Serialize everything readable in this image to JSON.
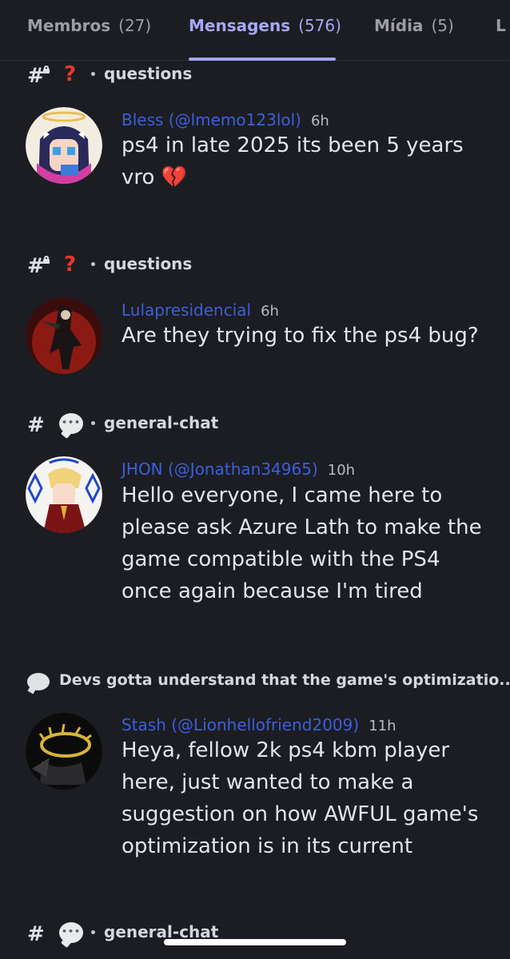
{
  "tabs": [
    {
      "label": "Membros",
      "count": "(27)"
    },
    {
      "label": "Mensagens",
      "count": "(576)"
    },
    {
      "label": "Mídia",
      "count": "(5)"
    },
    {
      "label": "L",
      "count": ""
    }
  ],
  "results": [
    {
      "channel": "questions",
      "channel_icons": [
        "hash-lock-icon",
        "red-question-mark-icon"
      ],
      "author": "Bless (@lmemo123lol)",
      "time": "6h",
      "message": "ps4 in late 2025 its been 5 years vro",
      "emoji": "💔"
    },
    {
      "channel": "questions",
      "channel_icons": [
        "hash-lock-icon",
        "red-question-mark-icon"
      ],
      "author": "Lulapresidencial",
      "time": "6h",
      "message": "Are they trying to fix the ps4 bug?"
    },
    {
      "channel": "general-chat",
      "channel_icons": [
        "hash-icon",
        "speech-bubble-icon"
      ],
      "author": "JHON (@Jonathan34965)",
      "time": "10h",
      "message": "Hello everyone, I came here to please ask Azure Lath to make the game compatible with the PS4 once again because I'm tired"
    },
    {
      "thread": "Devs gotta understand that the game's optimizatio...",
      "channel_icons": [
        "thread-bubble-icon"
      ],
      "author": "Stash (@Lionhellofriend2009)",
      "time": "11h",
      "message": "Heya, fellow 2k ps4 kbm player here, just wanted to make a suggestion on how AWFUL game's optimization is in its current"
    },
    {
      "channel": "general-chat",
      "channel_icons": [
        "hash-icon",
        "speech-bubble-icon"
      ]
    }
  ],
  "colors": {
    "background": "#1c1d22",
    "active_tab": "#a5a8f5",
    "author_link": "#3c5fdc",
    "question_mark": "#e8392e"
  }
}
